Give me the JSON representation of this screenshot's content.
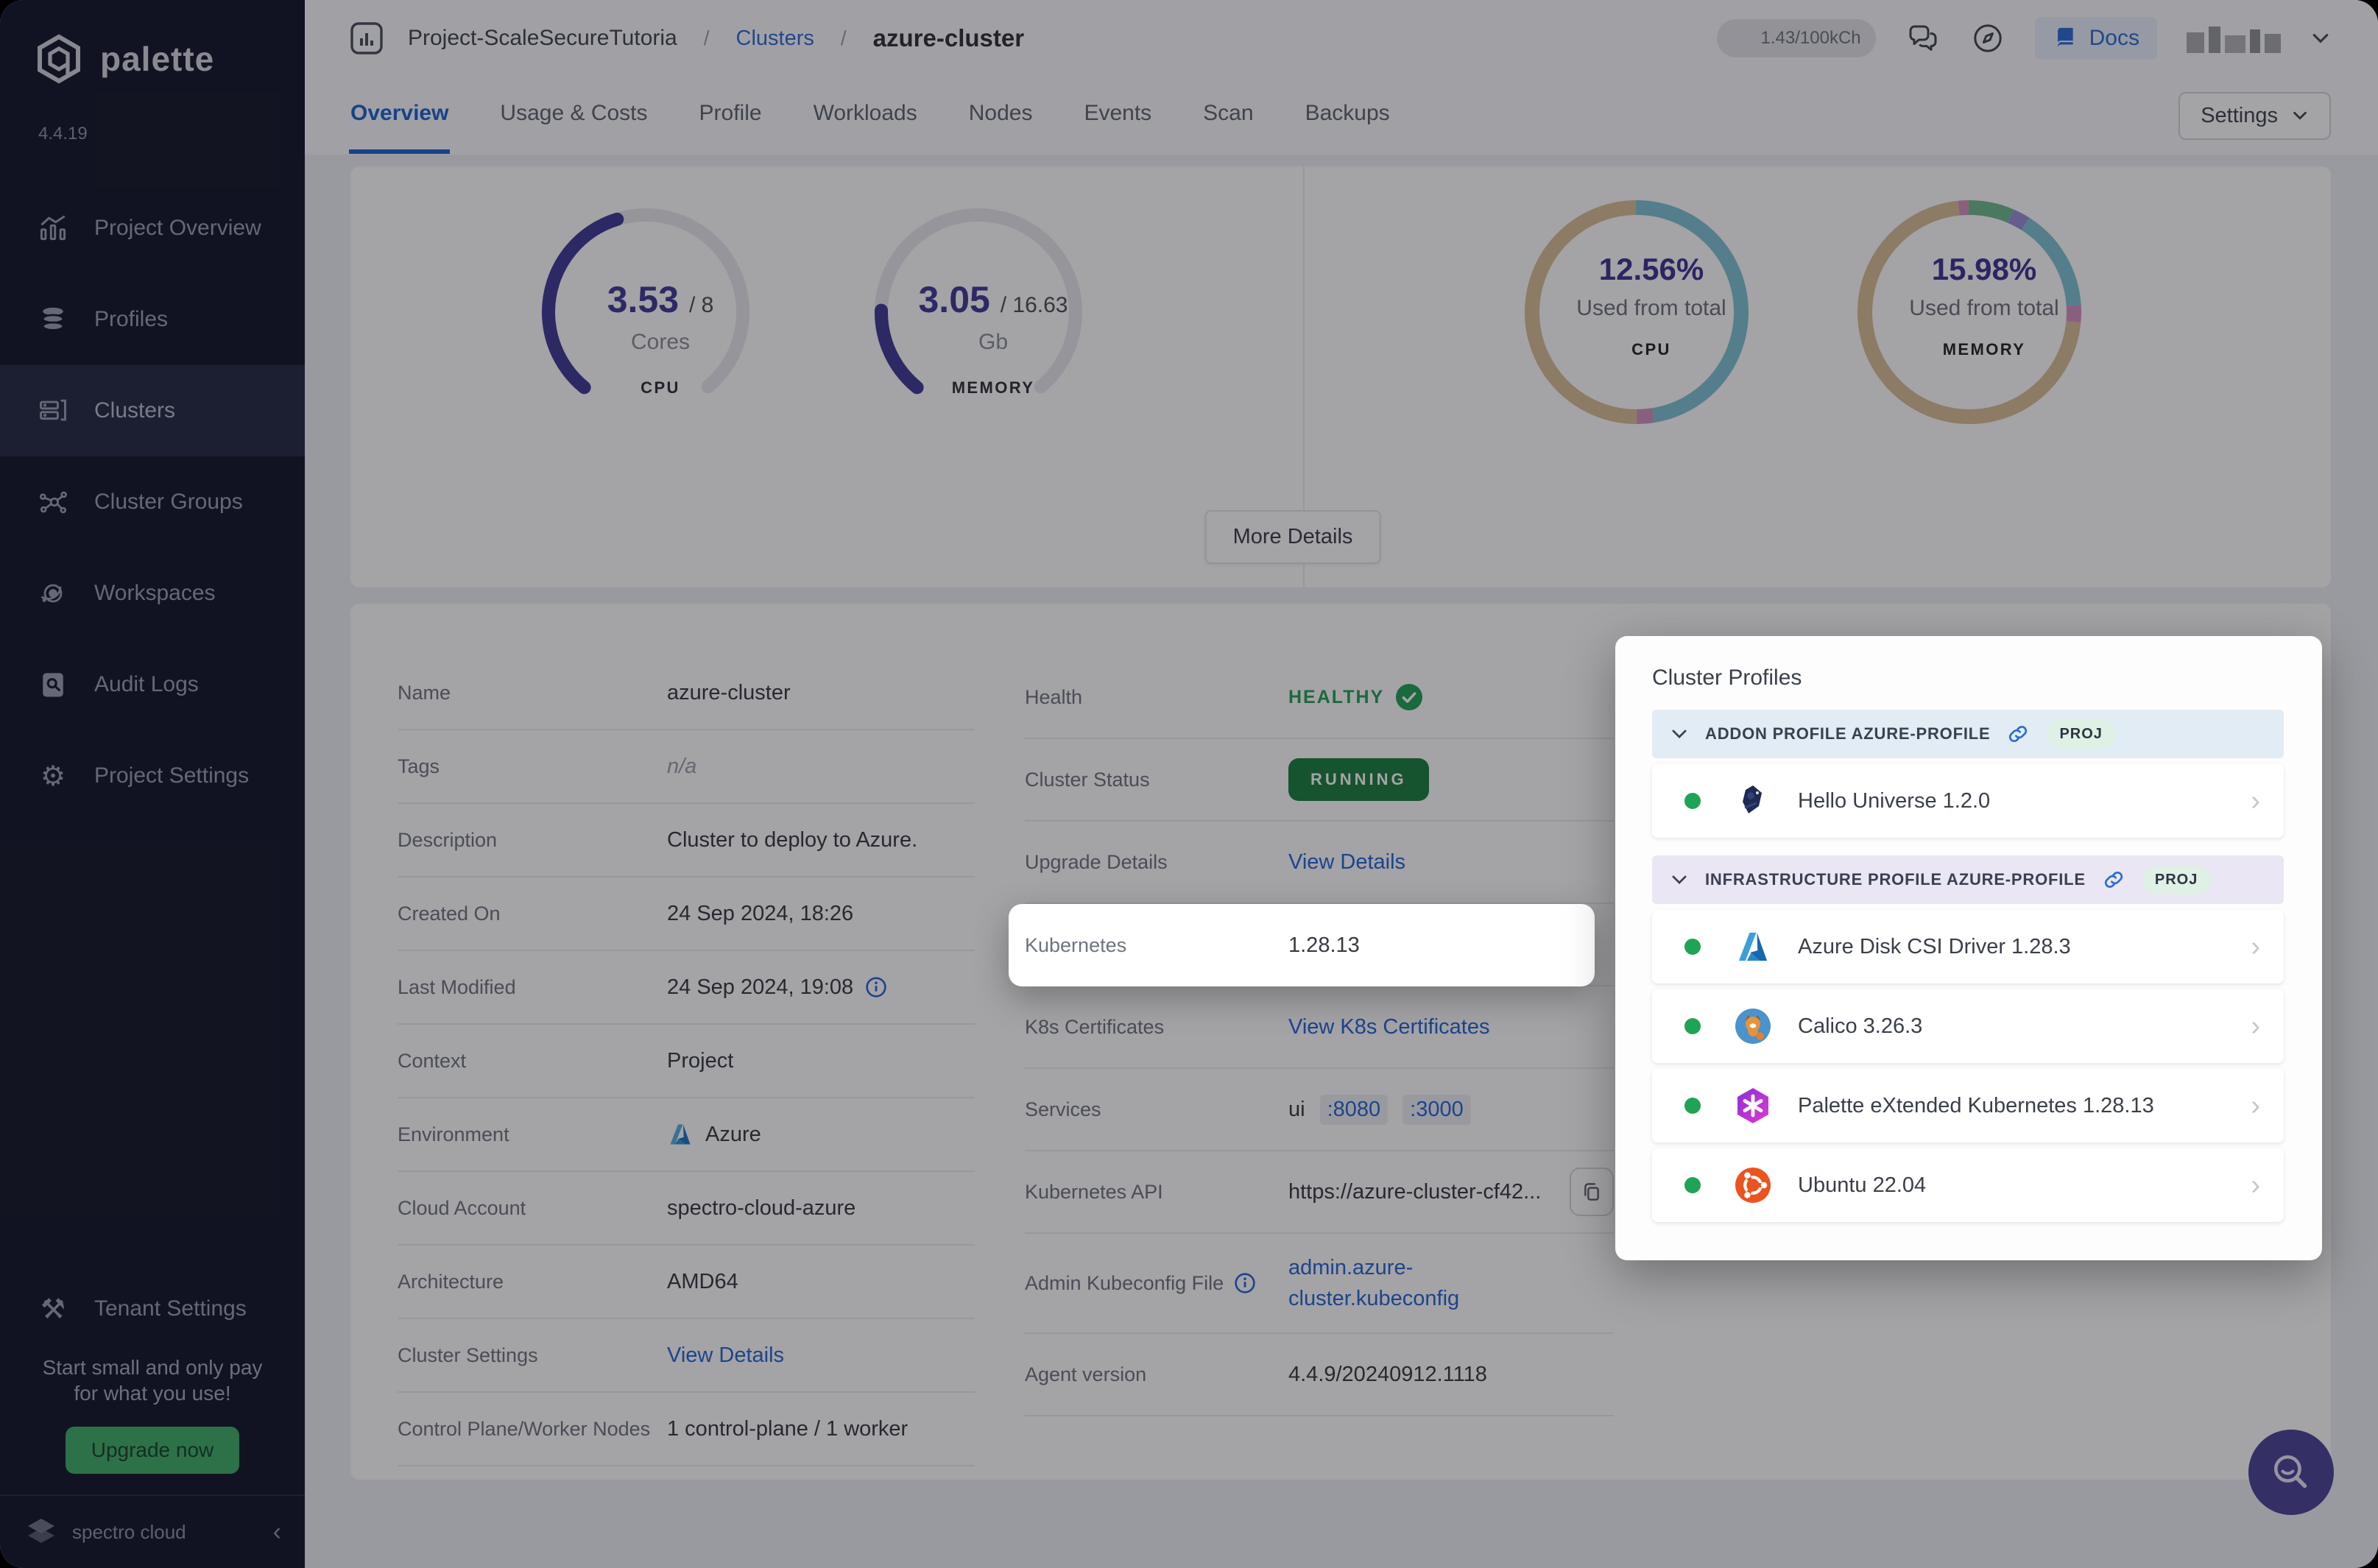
{
  "sidebar": {
    "brand": "palette",
    "version": "4.4.19",
    "items": [
      {
        "label": "Project Overview",
        "active": false
      },
      {
        "label": "Profiles",
        "active": false
      },
      {
        "label": "Clusters",
        "active": true
      },
      {
        "label": "Cluster Groups",
        "active": false
      },
      {
        "label": "Workspaces",
        "active": false
      },
      {
        "label": "Audit Logs",
        "active": false
      },
      {
        "label": "Project Settings",
        "active": false
      }
    ],
    "tenant_settings_label": "Tenant Settings",
    "upsell": {
      "line1": "Start small and only pay",
      "line2": "for what you use!",
      "upgrade_label": "Upgrade now"
    },
    "footer_brand": "spectro cloud"
  },
  "header": {
    "breadcrumb": {
      "project": "Project-ScaleSecureTutoria",
      "divider": "/",
      "section": "Clusters",
      "current": "azure-cluster"
    },
    "usage_badge": "1.43/100kCh",
    "docs_label": "Docs"
  },
  "tabs": {
    "items": [
      "Overview",
      "Usage & Costs",
      "Profile",
      "Workloads",
      "Nodes",
      "Events",
      "Scan",
      "Backups"
    ],
    "active": "Overview",
    "settings_label": "Settings"
  },
  "overview": {
    "gauges": {
      "cpu": {
        "value": "3.53",
        "total": "/ 8",
        "unit": "Cores",
        "label": "CPU",
        "fill_percent": 44,
        "color": "#3f3b96"
      },
      "memory": {
        "value": "3.05",
        "total": "/ 16.63",
        "unit": "Gb",
        "label": "MEMORY",
        "fill_percent": 18,
        "color": "#3f3b96"
      }
    },
    "donuts": {
      "cpu": {
        "percent": "12.56%",
        "caption": "Used from total",
        "label": "CPU",
        "segments": [
          {
            "color": "#7ec3d4",
            "value": 47.5
          },
          {
            "color": "#d392be",
            "value": 2.5
          },
          {
            "color": "#d9be96",
            "value": 50
          }
        ]
      },
      "memory": {
        "percent": "15.98%",
        "caption": "Used from total",
        "label": "MEMORY",
        "segments": [
          {
            "color": "#6fbc8e",
            "value": 6.5
          },
          {
            "color": "#9a8fd6",
            "value": 2.5
          },
          {
            "color": "#7ec3d4",
            "value": 15
          },
          {
            "color": "#d392be",
            "value": 2.5
          },
          {
            "color": "#d9be96",
            "value": 72
          },
          {
            "color": "#d392be",
            "value": 1.5
          }
        ]
      }
    },
    "more_details_label": "More Details"
  },
  "details": {
    "left": {
      "name": {
        "label": "Name",
        "value": "azure-cluster"
      },
      "tags": {
        "label": "Tags",
        "value": "n/a"
      },
      "description": {
        "label": "Description",
        "value": "Cluster to deploy to Azure."
      },
      "created_on": {
        "label": "Created On",
        "value": "24 Sep 2024, 18:26"
      },
      "last_modified": {
        "label": "Last Modified",
        "value": "24 Sep 2024, 19:08"
      },
      "context": {
        "label": "Context",
        "value": "Project"
      },
      "environment": {
        "label": "Environment",
        "value": "Azure"
      },
      "cloud_account": {
        "label": "Cloud Account",
        "value": "spectro-cloud-azure"
      },
      "architecture": {
        "label": "Architecture",
        "value": "AMD64"
      },
      "cluster_settings": {
        "label": "Cluster Settings",
        "value": "View Details"
      },
      "nodes": {
        "label": "Control Plane/Worker Nodes",
        "value": "1 control-plane / 1 worker"
      }
    },
    "right": {
      "health": {
        "label": "Health",
        "value": "HEALTHY"
      },
      "cluster_status": {
        "label": "Cluster Status",
        "value": "RUNNING"
      },
      "upgrade_details": {
        "label": "Upgrade Details",
        "value": "View Details"
      },
      "kubernetes": {
        "label": "Kubernetes",
        "value": "1.28.13"
      },
      "k8s_certificates": {
        "label": "K8s Certificates",
        "value": "View K8s Certificates"
      },
      "services": {
        "label": "Services",
        "app": "ui",
        "ports": [
          ":8080",
          ":3000"
        ]
      },
      "kubernetes_api": {
        "label": "Kubernetes API",
        "value": "https://azure-cluster-cf42..."
      },
      "admin_kubeconfig": {
        "label": "Admin Kubeconfig File",
        "value": "admin.azure-cluster.kubeconfig"
      },
      "agent_version": {
        "label": "Agent version",
        "value": "4.4.9/20240912.1118"
      }
    }
  },
  "cluster_profiles": {
    "title": "Cluster Profiles",
    "sections": [
      {
        "name": "ADDON PROFILE AZURE-PROFILE",
        "badge": "PROJ",
        "items": [
          {
            "name": "Hello Universe 1.2.0"
          }
        ]
      },
      {
        "name": "INFRASTRUCTURE PROFILE AZURE-PROFILE",
        "badge": "PROJ",
        "items": [
          {
            "name": "Azure Disk CSI Driver 1.28.3"
          },
          {
            "name": "Calico 3.26.3"
          },
          {
            "name": "Palette eXtended Kubernetes 1.28.13"
          },
          {
            "name": "Ubuntu 22.04"
          }
        ]
      }
    ]
  },
  "colors": {
    "accent_blue": "#2b6cd4",
    "healthy_green": "#21a457",
    "running_green": "#1a7f3f",
    "upgrade_green": "#3fae68",
    "gauge_indigo": "#3f3b96",
    "fab_purple": "#4b4496",
    "sidebar_bg": "#14172b",
    "overlay": "rgba(15,14,20,0.38)"
  }
}
